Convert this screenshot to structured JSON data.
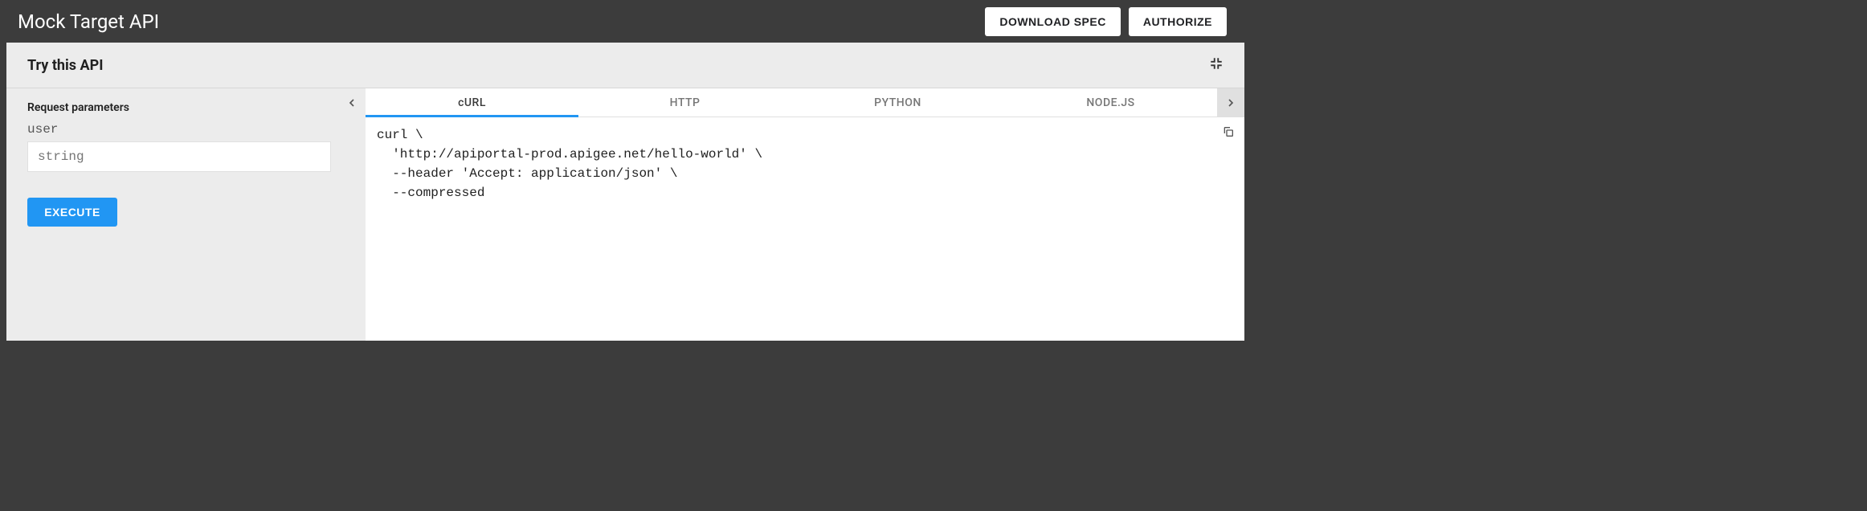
{
  "header": {
    "title": "Mock Target API",
    "download_label": "DOWNLOAD SPEC",
    "authorize_label": "AUTHORIZE"
  },
  "panel": {
    "heading": "Try this API"
  },
  "request": {
    "section_label": "Request parameters",
    "params": [
      {
        "name": "user",
        "placeholder": "string",
        "value": ""
      }
    ],
    "execute_label": "EXECUTE"
  },
  "code": {
    "tabs": [
      "cURL",
      "HTTP",
      "PYTHON",
      "NODE.JS"
    ],
    "active_tab": 0,
    "snippet": "curl \\\n  'http://apiportal-prod.apigee.net/hello-world' \\\n  --header 'Accept: application/json' \\\n  --compressed"
  }
}
